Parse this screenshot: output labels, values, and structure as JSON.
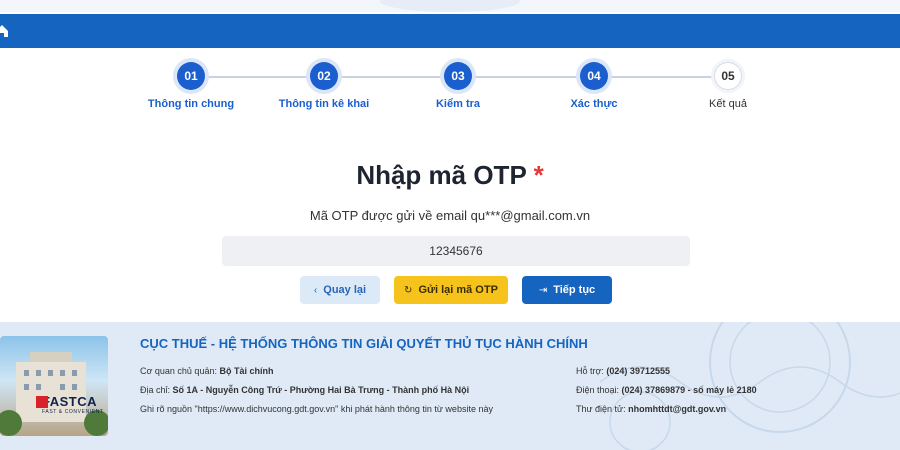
{
  "stepper": {
    "steps": [
      {
        "number": "01",
        "label": "Thông tin chung",
        "state": "active"
      },
      {
        "number": "02",
        "label": "Thông tin kê khai",
        "state": "active"
      },
      {
        "number": "03",
        "label": "Kiểm tra",
        "state": "active"
      },
      {
        "number": "04",
        "label": "Xác thực",
        "state": "active"
      },
      {
        "number": "05",
        "label": "Kết quả",
        "state": "pending"
      }
    ]
  },
  "otp": {
    "title": "Nhập mã OTP",
    "required_mark": "*",
    "description": "Mã OTP được gửi về email qu***@gmail.com.vn",
    "value": "12345676"
  },
  "actions": {
    "back_label": "Quay lại",
    "resend_label": "Gửi lại mã OTP",
    "next_label": "Tiếp tục"
  },
  "footer": {
    "logo_name": "FASTCA",
    "logo_tagline": "FAST & CONVENIENT",
    "title": "CỤC THUẾ - HỆ THỐNG THÔNG TIN GIẢI QUYẾT THỦ TỤC HÀNH CHÍNH",
    "agency_label": "Cơ quan chủ quản:",
    "agency_value": "Bộ Tài chính",
    "address_label": "Địa chỉ:",
    "address_value": "Số 1A - Nguyễn Công Trứ - Phường Hai Bà Trưng - Thành phố Hà Nội",
    "source_note": "Ghi rõ nguồn \"https://www.dichvucong.gdt.gov.vn\" khi phát hành thông tin từ website này",
    "support_label": "Hỗ trợ:",
    "support_value": "(024) 39712555",
    "phone_label": "Điện thoại:",
    "phone_value": "(024) 37869879 - số máy lẻ 2180",
    "email_label": "Thư điện tử:",
    "email_value": "nhomhttdt@gdt.gov.vn"
  },
  "colors": {
    "primary": "#1565c0",
    "step_active": "#1b5fcf",
    "resend_button": "#f6c31c",
    "required": "#e53935",
    "footer_bg": "#dfeaf6"
  },
  "icons": {
    "home": "home-icon",
    "back": "chevron-left-icon",
    "resend": "refresh-icon",
    "next": "arrow-right-icon"
  }
}
